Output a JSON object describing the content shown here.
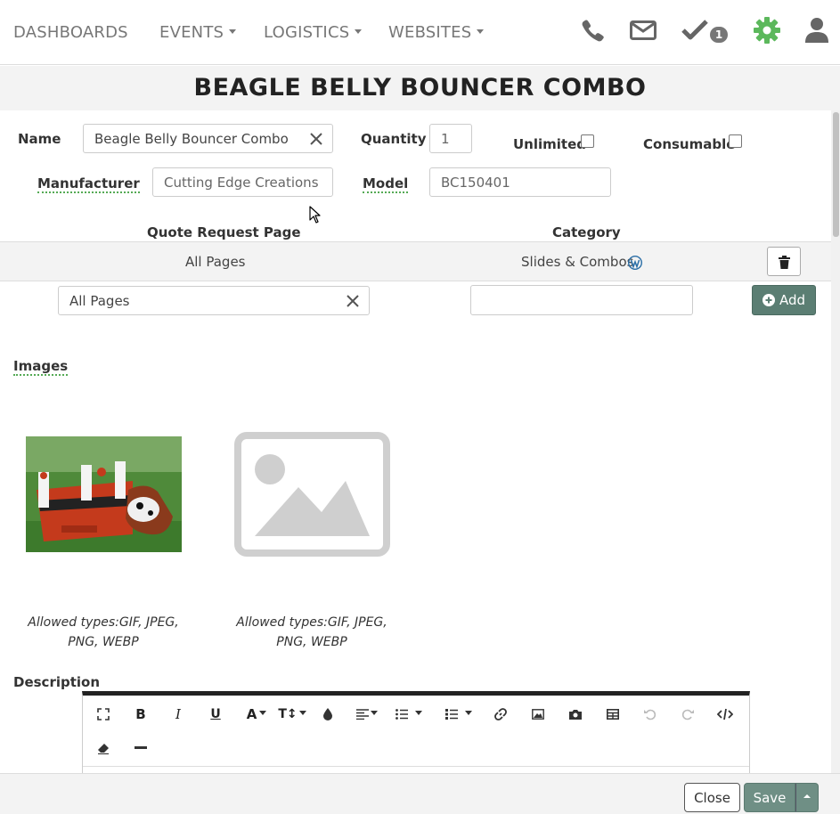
{
  "nav": {
    "items": [
      {
        "label": "DASHBOARDS",
        "dropdown": false
      },
      {
        "label": "EVENTS",
        "dropdown": true
      },
      {
        "label": "LOGISTICS",
        "dropdown": true
      },
      {
        "label": "WEBSITES",
        "dropdown": true
      }
    ],
    "icons": [
      "phone-icon",
      "envelope-icon",
      "check-icon",
      "gear-icon",
      "user-icon"
    ],
    "tasks_badge": "1",
    "accent_color": "#5cb85c"
  },
  "page": {
    "title": "BEAGLE BELLY BOUNCER COMBO"
  },
  "form": {
    "name_label": "Name",
    "name_value": "Beagle Belly Bouncer Combo",
    "quantity_label": "Quantity",
    "quantity_value": "1",
    "unlimited_label": "Unlimited",
    "unlimited_checked": false,
    "consumable_label": "Consumable",
    "consumable_checked": false,
    "manufacturer_label": "Manufacturer",
    "manufacturer_value": "Cutting Edge Creations",
    "model_label": "Model",
    "model_value": "BC150401"
  },
  "grid": {
    "col_page": "Quote Request Page",
    "col_category": "Category",
    "row": {
      "page": "All Pages",
      "category": "Slides & Combos"
    },
    "new_page_value": "All Pages",
    "new_category_value": "",
    "add_label": "Add"
  },
  "images": {
    "label": "Images",
    "slots": [
      {
        "caption": "Allowed types:GIF, JPEG, PNG, WEBP",
        "has_image": true
      },
      {
        "caption": "Allowed types:GIF, JPEG, PNG, WEBP",
        "has_image": false
      }
    ]
  },
  "description": {
    "label": "Description",
    "toolbar": [
      "fullscreen-icon",
      "bold-icon",
      "italic-icon",
      "underline-icon",
      "font-color-icon",
      "font-size-icon",
      "highlight-icon",
      "align-icon",
      "ordered-list-icon",
      "unordered-list-icon",
      "link-icon",
      "image-icon",
      "camera-icon",
      "table-icon",
      "undo-icon",
      "redo-icon",
      "code-view-icon",
      "eraser-icon",
      "horizontal-rule-icon"
    ]
  },
  "footer": {
    "close_label": "Close",
    "save_label": "Save"
  }
}
